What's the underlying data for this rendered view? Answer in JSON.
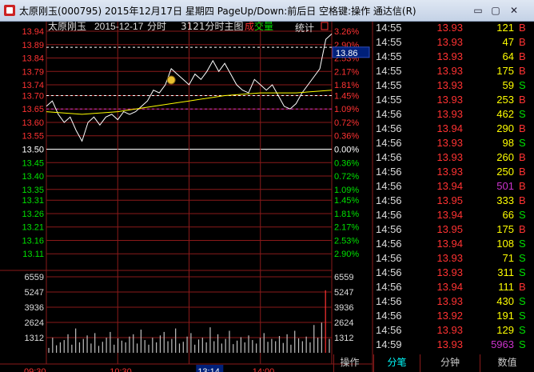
{
  "window": {
    "title": "太原刚玉(000795) 2015年12月17日 星期四 PageUp/Down:前后日 空格键:操作 通达信(R)",
    "min_glyph": "▭",
    "max_glyph": "▢",
    "close_glyph": "✕"
  },
  "chart_header": {
    "stock_name": "太原刚玉",
    "date": "2015-12-17",
    "mode": "分时",
    "code": "3121分时主图",
    "legend_a": "成",
    "legend_b": "交量",
    "stats_label": "统计",
    "current_price_box": "13.86"
  },
  "colors": {
    "up": "#ff3232",
    "down": "#00e000",
    "flat": "#ffffff",
    "grid": "#8a1a1a",
    "price_line": "#ffffff",
    "avg_line": "#ffff00",
    "volume": "#c0c0c0",
    "big_volume": "#cc33cc",
    "tick_time": "#dddddd",
    "active_tab": "#00ffff"
  },
  "chart_data": {
    "type": "line",
    "title": "",
    "preclose": 13.5,
    "price_ticks": [
      "13.94",
      "13.89",
      "13.84",
      "13.79",
      "13.74",
      "13.70",
      "13.65",
      "13.60",
      "13.55",
      "13.50",
      "13.45",
      "13.40",
      "13.35",
      "13.31",
      "13.26",
      "13.21",
      "13.16",
      "13.11"
    ],
    "pct_ticks": [
      "3.26%",
      "2.90%",
      "2.53%",
      "2.17%",
      "1.81%",
      "1.45%",
      "1.09%",
      "0.72%",
      "0.36%",
      "0.00%",
      "0.36%",
      "0.72%",
      "1.09%",
      "1.45%",
      "1.81%",
      "2.17%",
      "2.53%",
      "2.90%"
    ],
    "ylim": [
      13.06,
      13.94
    ],
    "volume_ticks": [
      "6559",
      "5247",
      "3936",
      "2624",
      "1312"
    ],
    "volume_ylim": [
      0,
      6559
    ],
    "x_ticks": [
      "09:30",
      "10:30",
      "13:14",
      "14:00"
    ],
    "cursor_time": "13:14",
    "series": [
      {
        "name": "",
        "role": "price",
        "x": [
          "09:30",
          "09:35",
          "09:40",
          "09:45",
          "09:50",
          "09:55",
          "10:00",
          "10:05",
          "10:10",
          "10:15",
          "10:20",
          "10:25",
          "10:30",
          "10:35",
          "10:40",
          "10:45",
          "10:50",
          "10:55",
          "11:00",
          "11:05",
          "11:10",
          "11:15",
          "11:20",
          "11:25",
          "11:30",
          "13:05",
          "13:10",
          "13:15",
          "13:20",
          "13:25",
          "13:30",
          "13:35",
          "13:40",
          "13:45",
          "13:50",
          "13:55",
          "14:00",
          "14:05",
          "14:10",
          "14:15",
          "14:20",
          "14:25",
          "14:30",
          "14:35",
          "14:40",
          "14:45",
          "14:50",
          "14:55",
          "15:00"
        ],
        "values": [
          13.66,
          13.68,
          13.63,
          13.6,
          13.62,
          13.57,
          13.53,
          13.6,
          13.62,
          13.59,
          13.62,
          13.63,
          13.61,
          13.64,
          13.63,
          13.64,
          13.66,
          13.68,
          13.72,
          13.71,
          13.74,
          13.8,
          13.78,
          13.76,
          13.74,
          13.78,
          13.76,
          13.79,
          13.83,
          13.79,
          13.82,
          13.78,
          13.74,
          13.72,
          13.71,
          13.76,
          13.74,
          13.72,
          13.74,
          13.7,
          13.66,
          13.65,
          13.67,
          13.71,
          13.74,
          13.77,
          13.8,
          13.91,
          13.93
        ]
      },
      {
        "name": "",
        "role": "average",
        "x": [
          "09:30",
          "10:00",
          "10:30",
          "11:00",
          "11:30",
          "13:30",
          "14:00",
          "14:30",
          "15:00"
        ],
        "values": [
          13.64,
          13.63,
          13.64,
          13.66,
          13.68,
          13.7,
          13.71,
          13.71,
          13.72
        ]
      }
    ],
    "volume_bars": [
      420,
      1300,
      650,
      900,
      1100,
      1600,
      700,
      2100,
      900,
      1200,
      1500,
      800,
      1700,
      600,
      950,
      1300,
      1800,
      700,
      1250,
      1050,
      900,
      1400,
      1600,
      800,
      2000,
      1100,
      700,
      1300,
      900,
      1500,
      1800,
      1000,
      1200,
      2100,
      800,
      950,
      1400,
      1700,
      700,
      1150,
      1300,
      900,
      2200,
      1000,
      1600,
      800,
      1200,
      1900,
      750,
      1050,
      1350,
      900,
      1500,
      1100,
      800,
      1300,
      1700,
      950,
      1200,
      1000,
      1450,
      850,
      1600,
      700,
      1900,
      1250,
      1000,
      1400,
      900,
      2400,
      1300,
      2600,
      5400,
      1200
    ]
  },
  "ticks": [
    {
      "time": "14:55",
      "price": "13.93",
      "vol": "121",
      "bs": "B"
    },
    {
      "time": "14:55",
      "price": "13.93",
      "vol": "47",
      "bs": "B"
    },
    {
      "time": "14:55",
      "price": "13.93",
      "vol": "64",
      "bs": "B"
    },
    {
      "time": "14:55",
      "price": "13.93",
      "vol": "175",
      "bs": "B"
    },
    {
      "time": "14:55",
      "price": "13.93",
      "vol": "59",
      "bs": "S"
    },
    {
      "time": "14:55",
      "price": "13.93",
      "vol": "253",
      "bs": "B"
    },
    {
      "time": "14:56",
      "price": "13.93",
      "vol": "462",
      "bs": "S"
    },
    {
      "time": "14:56",
      "price": "13.94",
      "vol": "290",
      "bs": "B"
    },
    {
      "time": "14:56",
      "price": "13.93",
      "vol": "98",
      "bs": "S"
    },
    {
      "time": "14:56",
      "price": "13.93",
      "vol": "260",
      "bs": "B"
    },
    {
      "time": "14:56",
      "price": "13.93",
      "vol": "250",
      "bs": "B"
    },
    {
      "time": "14:56",
      "price": "13.94",
      "vol": "501",
      "bs": "B"
    },
    {
      "time": "14:56",
      "price": "13.95",
      "vol": "333",
      "bs": "B"
    },
    {
      "time": "14:56",
      "price": "13.94",
      "vol": "66",
      "bs": "S"
    },
    {
      "time": "14:56",
      "price": "13.95",
      "vol": "175",
      "bs": "B"
    },
    {
      "time": "14:56",
      "price": "13.94",
      "vol": "108",
      "bs": "S"
    },
    {
      "time": "14:56",
      "price": "13.93",
      "vol": "71",
      "bs": "S"
    },
    {
      "time": "14:56",
      "price": "13.93",
      "vol": "311",
      "bs": "S"
    },
    {
      "time": "14:56",
      "price": "13.94",
      "vol": "111",
      "bs": "B"
    },
    {
      "time": "14:56",
      "price": "13.93",
      "vol": "430",
      "bs": "S"
    },
    {
      "time": "14:56",
      "price": "13.92",
      "vol": "191",
      "bs": "S"
    },
    {
      "time": "14:56",
      "price": "13.93",
      "vol": "129",
      "bs": "S"
    },
    {
      "time": "14:59",
      "price": "13.93",
      "vol": "5963",
      "bs": "S"
    }
  ],
  "tabs": [
    "操作",
    "分笔",
    "分钟",
    "数值"
  ]
}
